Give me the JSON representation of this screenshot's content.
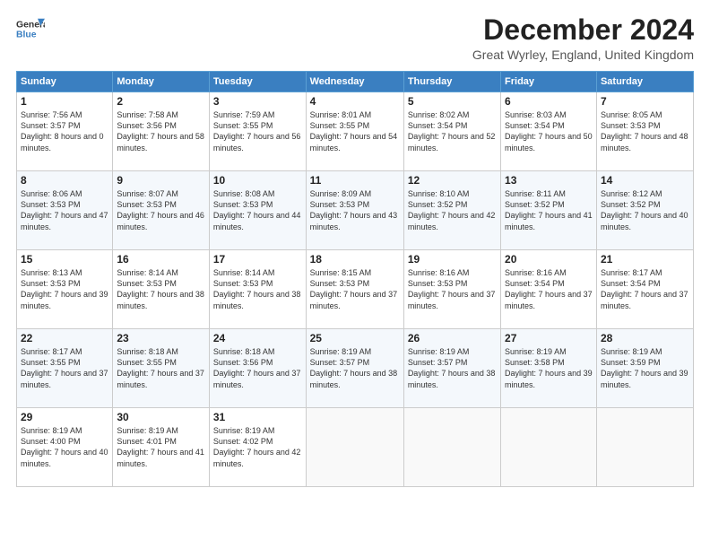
{
  "header": {
    "logo_line1": "General",
    "logo_line2": "Blue",
    "month_title": "December 2024",
    "location": "Great Wyrley, England, United Kingdom"
  },
  "days_of_week": [
    "Sunday",
    "Monday",
    "Tuesday",
    "Wednesday",
    "Thursday",
    "Friday",
    "Saturday"
  ],
  "weeks": [
    [
      {
        "num": "1",
        "rise": "Sunrise: 7:56 AM",
        "set": "Sunset: 3:57 PM",
        "daylight": "Daylight: 8 hours and 0 minutes."
      },
      {
        "num": "2",
        "rise": "Sunrise: 7:58 AM",
        "set": "Sunset: 3:56 PM",
        "daylight": "Daylight: 7 hours and 58 minutes."
      },
      {
        "num": "3",
        "rise": "Sunrise: 7:59 AM",
        "set": "Sunset: 3:55 PM",
        "daylight": "Daylight: 7 hours and 56 minutes."
      },
      {
        "num": "4",
        "rise": "Sunrise: 8:01 AM",
        "set": "Sunset: 3:55 PM",
        "daylight": "Daylight: 7 hours and 54 minutes."
      },
      {
        "num": "5",
        "rise": "Sunrise: 8:02 AM",
        "set": "Sunset: 3:54 PM",
        "daylight": "Daylight: 7 hours and 52 minutes."
      },
      {
        "num": "6",
        "rise": "Sunrise: 8:03 AM",
        "set": "Sunset: 3:54 PM",
        "daylight": "Daylight: 7 hours and 50 minutes."
      },
      {
        "num": "7",
        "rise": "Sunrise: 8:05 AM",
        "set": "Sunset: 3:53 PM",
        "daylight": "Daylight: 7 hours and 48 minutes."
      }
    ],
    [
      {
        "num": "8",
        "rise": "Sunrise: 8:06 AM",
        "set": "Sunset: 3:53 PM",
        "daylight": "Daylight: 7 hours and 47 minutes."
      },
      {
        "num": "9",
        "rise": "Sunrise: 8:07 AM",
        "set": "Sunset: 3:53 PM",
        "daylight": "Daylight: 7 hours and 46 minutes."
      },
      {
        "num": "10",
        "rise": "Sunrise: 8:08 AM",
        "set": "Sunset: 3:53 PM",
        "daylight": "Daylight: 7 hours and 44 minutes."
      },
      {
        "num": "11",
        "rise": "Sunrise: 8:09 AM",
        "set": "Sunset: 3:53 PM",
        "daylight": "Daylight: 7 hours and 43 minutes."
      },
      {
        "num": "12",
        "rise": "Sunrise: 8:10 AM",
        "set": "Sunset: 3:52 PM",
        "daylight": "Daylight: 7 hours and 42 minutes."
      },
      {
        "num": "13",
        "rise": "Sunrise: 8:11 AM",
        "set": "Sunset: 3:52 PM",
        "daylight": "Daylight: 7 hours and 41 minutes."
      },
      {
        "num": "14",
        "rise": "Sunrise: 8:12 AM",
        "set": "Sunset: 3:52 PM",
        "daylight": "Daylight: 7 hours and 40 minutes."
      }
    ],
    [
      {
        "num": "15",
        "rise": "Sunrise: 8:13 AM",
        "set": "Sunset: 3:53 PM",
        "daylight": "Daylight: 7 hours and 39 minutes."
      },
      {
        "num": "16",
        "rise": "Sunrise: 8:14 AM",
        "set": "Sunset: 3:53 PM",
        "daylight": "Daylight: 7 hours and 38 minutes."
      },
      {
        "num": "17",
        "rise": "Sunrise: 8:14 AM",
        "set": "Sunset: 3:53 PM",
        "daylight": "Daylight: 7 hours and 38 minutes."
      },
      {
        "num": "18",
        "rise": "Sunrise: 8:15 AM",
        "set": "Sunset: 3:53 PM",
        "daylight": "Daylight: 7 hours and 37 minutes."
      },
      {
        "num": "19",
        "rise": "Sunrise: 8:16 AM",
        "set": "Sunset: 3:53 PM",
        "daylight": "Daylight: 7 hours and 37 minutes."
      },
      {
        "num": "20",
        "rise": "Sunrise: 8:16 AM",
        "set": "Sunset: 3:54 PM",
        "daylight": "Daylight: 7 hours and 37 minutes."
      },
      {
        "num": "21",
        "rise": "Sunrise: 8:17 AM",
        "set": "Sunset: 3:54 PM",
        "daylight": "Daylight: 7 hours and 37 minutes."
      }
    ],
    [
      {
        "num": "22",
        "rise": "Sunrise: 8:17 AM",
        "set": "Sunset: 3:55 PM",
        "daylight": "Daylight: 7 hours and 37 minutes."
      },
      {
        "num": "23",
        "rise": "Sunrise: 8:18 AM",
        "set": "Sunset: 3:55 PM",
        "daylight": "Daylight: 7 hours and 37 minutes."
      },
      {
        "num": "24",
        "rise": "Sunrise: 8:18 AM",
        "set": "Sunset: 3:56 PM",
        "daylight": "Daylight: 7 hours and 37 minutes."
      },
      {
        "num": "25",
        "rise": "Sunrise: 8:19 AM",
        "set": "Sunset: 3:57 PM",
        "daylight": "Daylight: 7 hours and 38 minutes."
      },
      {
        "num": "26",
        "rise": "Sunrise: 8:19 AM",
        "set": "Sunset: 3:57 PM",
        "daylight": "Daylight: 7 hours and 38 minutes."
      },
      {
        "num": "27",
        "rise": "Sunrise: 8:19 AM",
        "set": "Sunset: 3:58 PM",
        "daylight": "Daylight: 7 hours and 39 minutes."
      },
      {
        "num": "28",
        "rise": "Sunrise: 8:19 AM",
        "set": "Sunset: 3:59 PM",
        "daylight": "Daylight: 7 hours and 39 minutes."
      }
    ],
    [
      {
        "num": "29",
        "rise": "Sunrise: 8:19 AM",
        "set": "Sunset: 4:00 PM",
        "daylight": "Daylight: 7 hours and 40 minutes."
      },
      {
        "num": "30",
        "rise": "Sunrise: 8:19 AM",
        "set": "Sunset: 4:01 PM",
        "daylight": "Daylight: 7 hours and 41 minutes."
      },
      {
        "num": "31",
        "rise": "Sunrise: 8:19 AM",
        "set": "Sunset: 4:02 PM",
        "daylight": "Daylight: 7 hours and 42 minutes."
      },
      null,
      null,
      null,
      null
    ]
  ]
}
